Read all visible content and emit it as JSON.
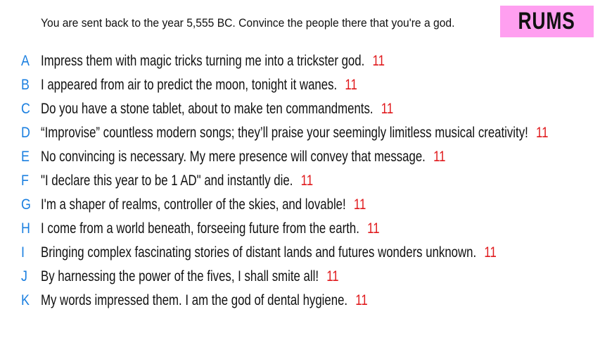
{
  "prompt": "You are sent back to the year 5,555 BC. Convince the people there that you're a god.",
  "logo": "RUMS",
  "colors": {
    "letter": "#1a7fe0",
    "score": "#e0191c",
    "logo_bg": "#ff9ff0"
  },
  "answers": [
    {
      "letter": "A",
      "text": "Impress them with magic tricks turning me into a trickster god.",
      "score": "11"
    },
    {
      "letter": "B",
      "text": "I appeared from air to predict the moon, tonight it wanes.",
      "score": "11"
    },
    {
      "letter": "C",
      "text": "Do you have a stone tablet, about to make ten commandments.",
      "score": "11"
    },
    {
      "letter": "D",
      "text": "“Improvise” countless modern songs; they’ll praise your seemingly limitless musical creativity!",
      "score": "11"
    },
    {
      "letter": "E",
      "text": "No convincing is necessary. My mere presence will convey that message.",
      "score": "11"
    },
    {
      "letter": "F",
      "text": "\"I declare this year to be 1 AD\" and instantly die.",
      "score": "11"
    },
    {
      "letter": "G",
      "text": "I'm a shaper of realms, controller of the skies, and lovable!",
      "score": "11"
    },
    {
      "letter": "H",
      "text": "I come from a world beneath, forseeing future from the earth.",
      "score": "11"
    },
    {
      "letter": "I",
      "text": "Bringing complex fascinating stories of distant lands and futures wonders unknown.",
      "score": "11"
    },
    {
      "letter": "J",
      "text": "By harnessing the power of the fives, I shall smite all!",
      "score": "11"
    },
    {
      "letter": "K",
      "text": "My words impressed them. I am the god of dental hygiene.",
      "score": "11"
    }
  ]
}
